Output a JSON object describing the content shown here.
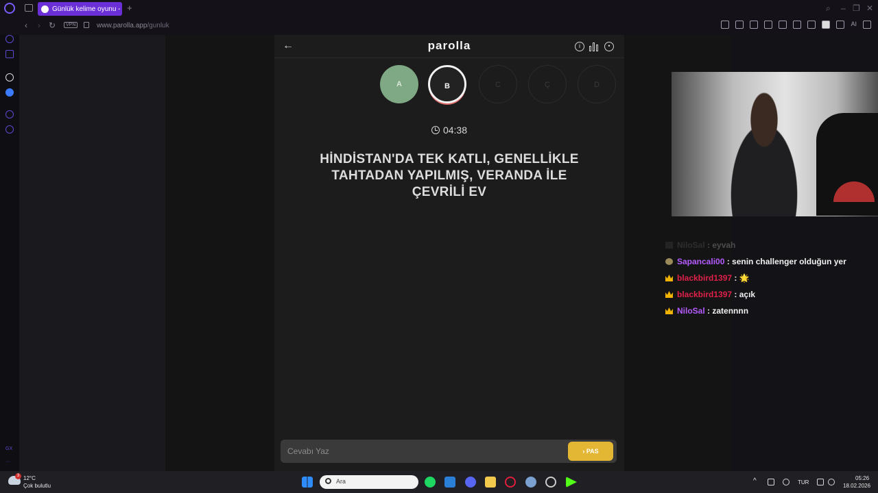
{
  "browser": {
    "tab_title": "Günlük kelime oyunu - par",
    "vpn_label": "VPN",
    "url_domain": "www.parolla.app",
    "url_path": "/gunluk",
    "ai_label": "AI",
    "sidebar_bottom_label": "GX"
  },
  "game": {
    "logo": "parolla",
    "letters": [
      {
        "letter": "A",
        "state": "done"
      },
      {
        "letter": "B",
        "state": "active"
      },
      {
        "letter": "C",
        "state": "pending"
      },
      {
        "letter": "Ç",
        "state": "pending"
      },
      {
        "letter": "D",
        "state": "pending"
      }
    ],
    "timer": "04:38",
    "question_lines": [
      "HİNDİSTAN'DA TEK KATLI, GENELLİKLE",
      "TAHTADAN YAPILMIŞ, VERANDA İLE",
      "ÇEVRİLİ EV"
    ],
    "answer_placeholder": "Cevabı Yaz",
    "pass_label": "PAS",
    "pass_chevron": "›"
  },
  "chat": {
    "messages": [
      {
        "user": "NiloSal",
        "text": "eyvah",
        "user_color": "#7a7a7a",
        "badge": "sq",
        "faded": true
      },
      {
        "user": "Sapancali00",
        "text": "senin challenger olduğun yer",
        "user_color": "#b45cff",
        "badge": "sprout",
        "faded": false
      },
      {
        "user": "blackbird1397",
        "text": "🌟",
        "user_color": "#e0204a",
        "badge": "crown",
        "faded": false
      },
      {
        "user": "blackbird1397",
        "text": "açık",
        "user_color": "#e0204a",
        "badge": "crown",
        "faded": false
      },
      {
        "user": "NiloSal",
        "text": "zatennnn",
        "user_color": "#b45cff",
        "badge": "crown",
        "faded": false
      }
    ]
  },
  "taskbar": {
    "weather_temp": "12°C",
    "weather_desc": "Çok bulutlu",
    "weather_badge": "3",
    "search_placeholder": "Ara",
    "lang": "TUR",
    "time": "05:26",
    "date": "18.02.2026"
  }
}
